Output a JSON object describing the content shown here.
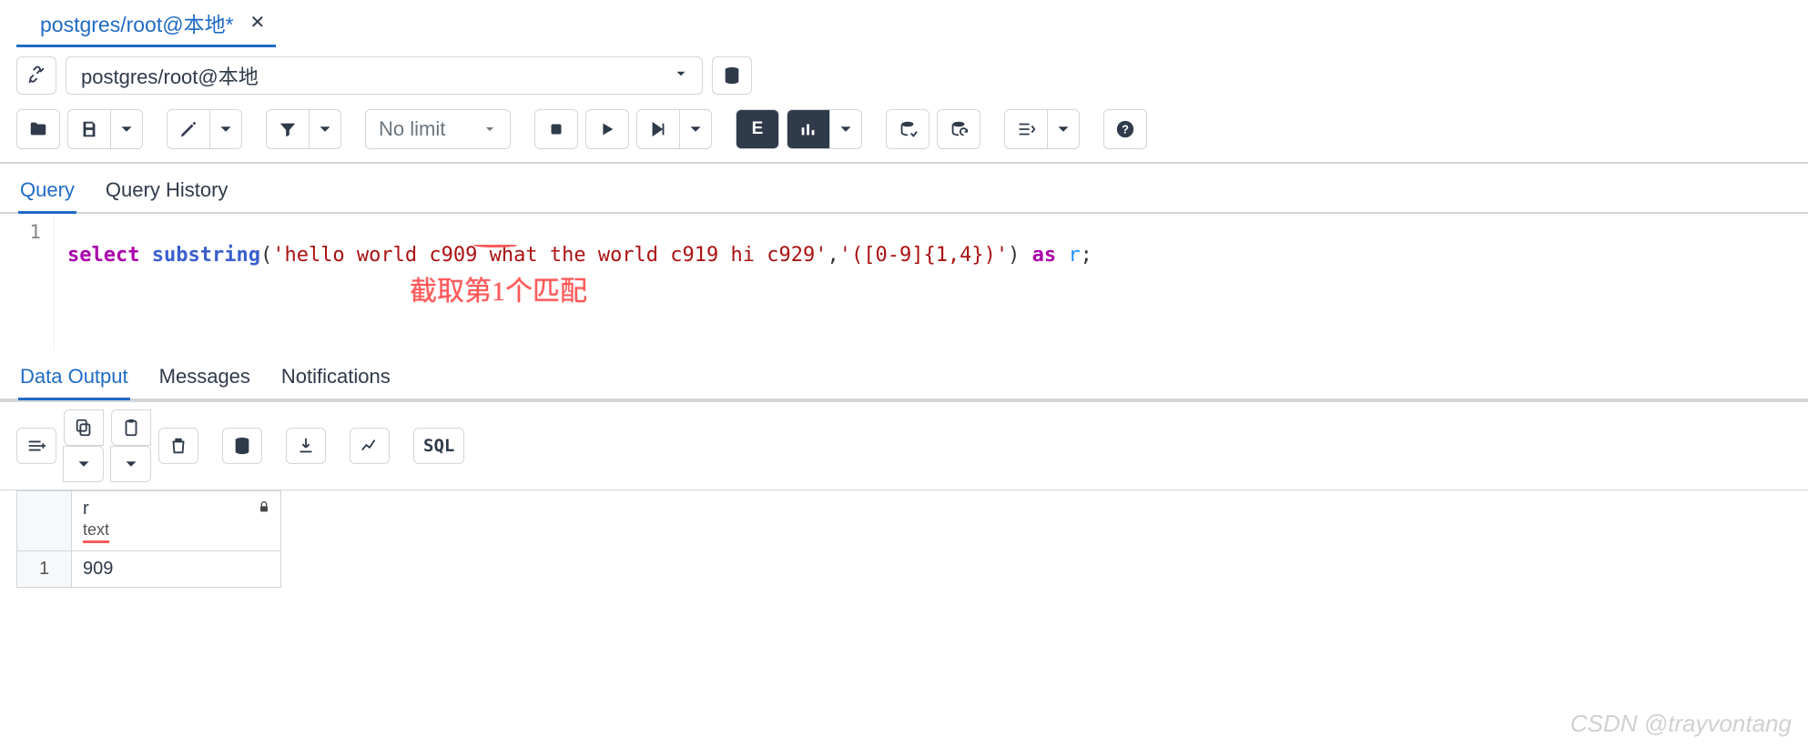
{
  "tab": {
    "title": "postgres/root@本地*",
    "close": "✕"
  },
  "conn": {
    "value": "postgres/root@本地"
  },
  "toolbar": {
    "limit": "No limit",
    "e_badge": "E",
    "sql_btn": "SQL"
  },
  "upper_tabs": {
    "query": "Query",
    "history": "Query History"
  },
  "editor": {
    "line_no": "1",
    "kw_select": "select",
    "fn": "substring",
    "open": "(",
    "str1": "'hello world c909 what the world c919 hi c929'",
    "comma": ",",
    "str2": "'([0-9]{1,4})'",
    "close": ")",
    "kw_as": "as",
    "alias": "r",
    "semi": ";",
    "annotation": "截取第1个匹配"
  },
  "lower_tabs": {
    "data": "Data Output",
    "messages": "Messages",
    "notifications": "Notifications"
  },
  "result": {
    "column_name": "r",
    "column_type": "text",
    "rows": [
      {
        "n": "1",
        "v": "909"
      }
    ]
  },
  "watermark": "CSDN @trayvontang"
}
